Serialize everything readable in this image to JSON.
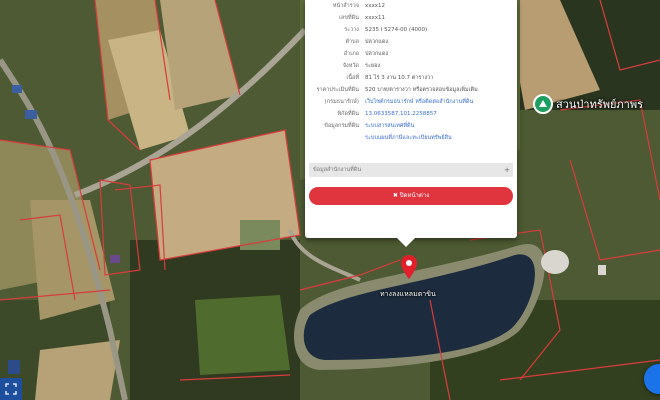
{
  "popup": {
    "rows": [
      {
        "label": "หน้าสำรวจ",
        "value": "xxxx12",
        "style": "plain"
      },
      {
        "label": "เลขที่ดิน",
        "value": "xxxx11",
        "style": "plain"
      },
      {
        "label": "ระวาง",
        "value": "5235 I 5274-00 (4000)",
        "style": "plain"
      },
      {
        "label": "ตำบล",
        "value": "ปลวกแดง",
        "style": "plain"
      },
      {
        "label": "อำเภอ",
        "value": "ปลวกแดง",
        "style": "plain"
      },
      {
        "label": "จังหวัด",
        "value": "ระยอง",
        "style": "plain"
      },
      {
        "label": "เนื้อที่",
        "value": "81 ไร่ 3 งาน 10.7 ตารางวา",
        "style": "plain"
      },
      {
        "label": "ราคาประเมินที่ดิน",
        "value": "520 บาท/ตารางวา หรือตรวจสอบข้อมูลเพิ่มเติม",
        "style": "plain"
      },
      {
        "label": "(กรมธนารักษ์)",
        "value": "เว็บไซต์กรมธนารักษ์ หรือติดต่อสำนักงานที่ดิน",
        "style": "link"
      },
      {
        "label": "พิกัดที่ดิน",
        "value": "13.0633587,101.2258857",
        "style": "link"
      },
      {
        "label": "ข้อมูลกรมที่ดิน",
        "value": "ระบบสารสนเทศที่ดิน",
        "style": "link"
      },
      {
        "label": "",
        "value": "ระบบแผนที่ภาษีและทะเบียนทรัพย์สิน",
        "style": "link"
      }
    ],
    "section_title": "ข้อมูลสำนักงานที่ดิน",
    "section_toggle": "+",
    "close_label": "✖ ปิดหน้าต่าง"
  },
  "map": {
    "pond_label": "ทางลงแหลมตาขิน",
    "poi_label": "สวนป่าทรัพย์ภาพร",
    "poi_icon": "park-tree-icon",
    "pin_icon": "location-pin-icon",
    "fab_icon": "locate-button-icon",
    "tool_icon": "fullscreen-tool-icon"
  },
  "colors": {
    "close_button": "#e0343f",
    "link": "#3a6fd1",
    "parcel_border": "#d93c3c",
    "pin": "#e2202c",
    "poi": "#1f9e62"
  }
}
